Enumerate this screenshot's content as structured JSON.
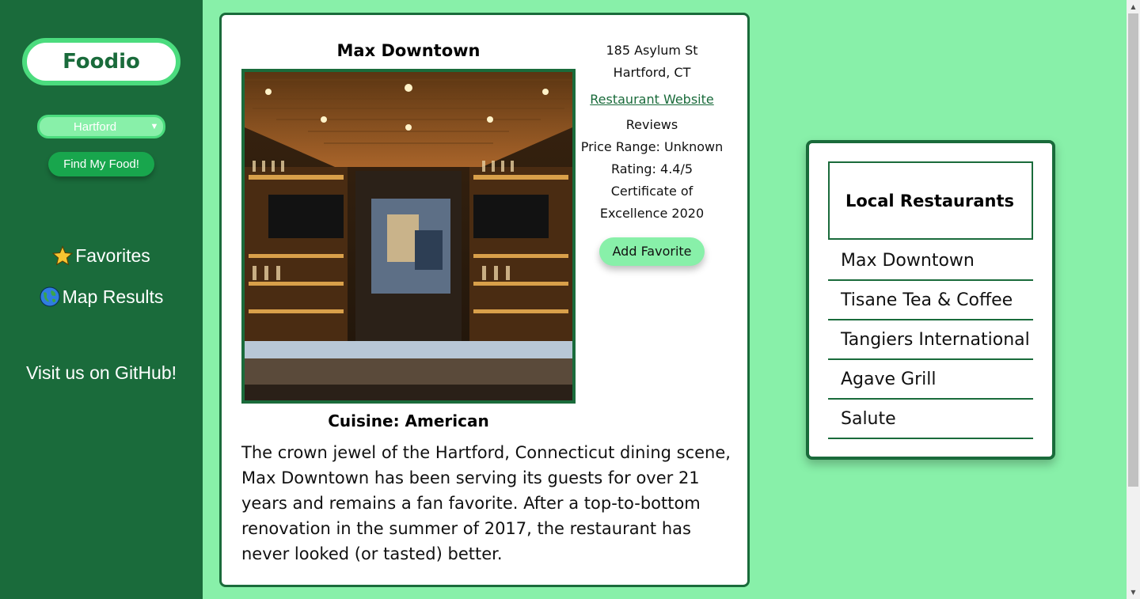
{
  "sidebar": {
    "logo": "Foodio",
    "city_select": {
      "value": "Hartford"
    },
    "find_button": "Find My Food!",
    "nav": {
      "favorites": "Favorites",
      "map_results": "Map Results",
      "github": "Visit us on GitHub!"
    },
    "icons": {
      "favorites": "star-icon",
      "map_results": "globe-icon"
    }
  },
  "restaurant": {
    "name": "Max Downtown",
    "address_line1": "185 Asylum St",
    "address_line2": "Hartford, CT",
    "website_link": "Restaurant Website",
    "reviews_heading": "Reviews",
    "price_range": "Price Range: Unknown",
    "rating": "Rating: 4.4/5",
    "certificate": "Certificate of Excellence 2020",
    "add_favorite": "Add Favorite",
    "cuisine": "Cuisine: American",
    "description": "The crown jewel of the Hartford, Connecticut dining scene, Max Downtown has been serving its guests for over 21 years and remains a fan favorite. After a top-to-bottom renovation in the summer of 2017, the restaurant has never looked (or tasted) better."
  },
  "local_restaurants": {
    "title": "Local Restaurants",
    "items": [
      "Max Downtown",
      "Tisane Tea & Coffee",
      "Tangiers International",
      "Agave Grill",
      "Salute"
    ]
  },
  "colors": {
    "page_background": "#88f0a9",
    "sidebar": "#1a6b3b",
    "accent": "#4bdc7e",
    "button": "#18a64d"
  }
}
